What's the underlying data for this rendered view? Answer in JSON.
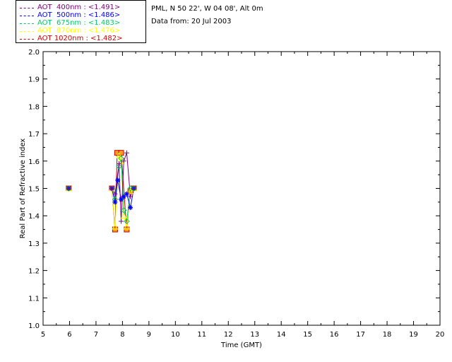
{
  "header": {
    "site": "PML, N 50 22', W 04 08', Alt 0m",
    "date": "Data from: 20 Jul 2003"
  },
  "chart_data": {
    "type": "line",
    "xlabel": "Time (GMT)",
    "ylabel": "Real Part of Refractive index",
    "xlim": [
      5,
      20
    ],
    "ylim": [
      1.0,
      2.0
    ],
    "xticks": [
      5,
      6,
      7,
      8,
      9,
      10,
      11,
      12,
      13,
      14,
      15,
      16,
      17,
      18,
      19,
      20
    ],
    "yticks": [
      1.0,
      1.1,
      1.2,
      1.3,
      1.4,
      1.5,
      1.6,
      1.7,
      1.8,
      1.9,
      2.0
    ],
    "grid": false,
    "legend_position": "top-left outside",
    "series": [
      {
        "name": "AOT  400nm : <1.491>",
        "color": "#800080",
        "marker": "plus",
        "x": [
          5.97,
          7.6,
          7.72,
          7.87,
          7.95,
          8.05,
          8.16,
          8.3,
          8.43
        ],
        "y": [
          1.5,
          1.5,
          1.48,
          1.59,
          1.38,
          1.6,
          1.63,
          1.47,
          1.5
        ]
      },
      {
        "name": "AOT  500nm : <1.486>",
        "color": "#0000ff",
        "marker": "asterisk",
        "x": [
          5.97,
          7.6,
          7.72,
          7.82,
          7.95,
          8.05,
          8.16,
          8.3,
          8.43
        ],
        "y": [
          1.5,
          1.5,
          1.45,
          1.53,
          1.46,
          1.47,
          1.48,
          1.43,
          1.5
        ]
      },
      {
        "name": "AOT  675nm : <1.483>",
        "color": "#00cc66",
        "marker": "diamond",
        "x": [
          5.97,
          7.6,
          7.72,
          7.87,
          7.95,
          8.05,
          8.16,
          8.3,
          8.43
        ],
        "y": [
          1.5,
          1.5,
          1.46,
          1.58,
          1.61,
          1.42,
          1.38,
          1.5,
          1.5
        ]
      },
      {
        "name": "AOT  870nm : <1.476>",
        "color": "#ffff00",
        "marker": "triangle",
        "x": [
          5.97,
          7.6,
          7.72,
          7.87,
          7.95,
          8.05,
          8.16,
          8.3,
          8.43
        ],
        "y": [
          1.5,
          1.5,
          1.36,
          1.62,
          1.6,
          1.4,
          1.36,
          1.49,
          1.5
        ]
      },
      {
        "name": "AOT 1020nm : <1.482>",
        "color": "#cc0000",
        "marker": "square",
        "x": [
          5.97,
          7.6,
          7.72,
          7.8,
          7.95,
          8.16,
          8.3,
          8.43
        ],
        "y": [
          1.5,
          1.5,
          1.35,
          1.63,
          1.63,
          1.35,
          1.49,
          1.5
        ]
      }
    ]
  }
}
